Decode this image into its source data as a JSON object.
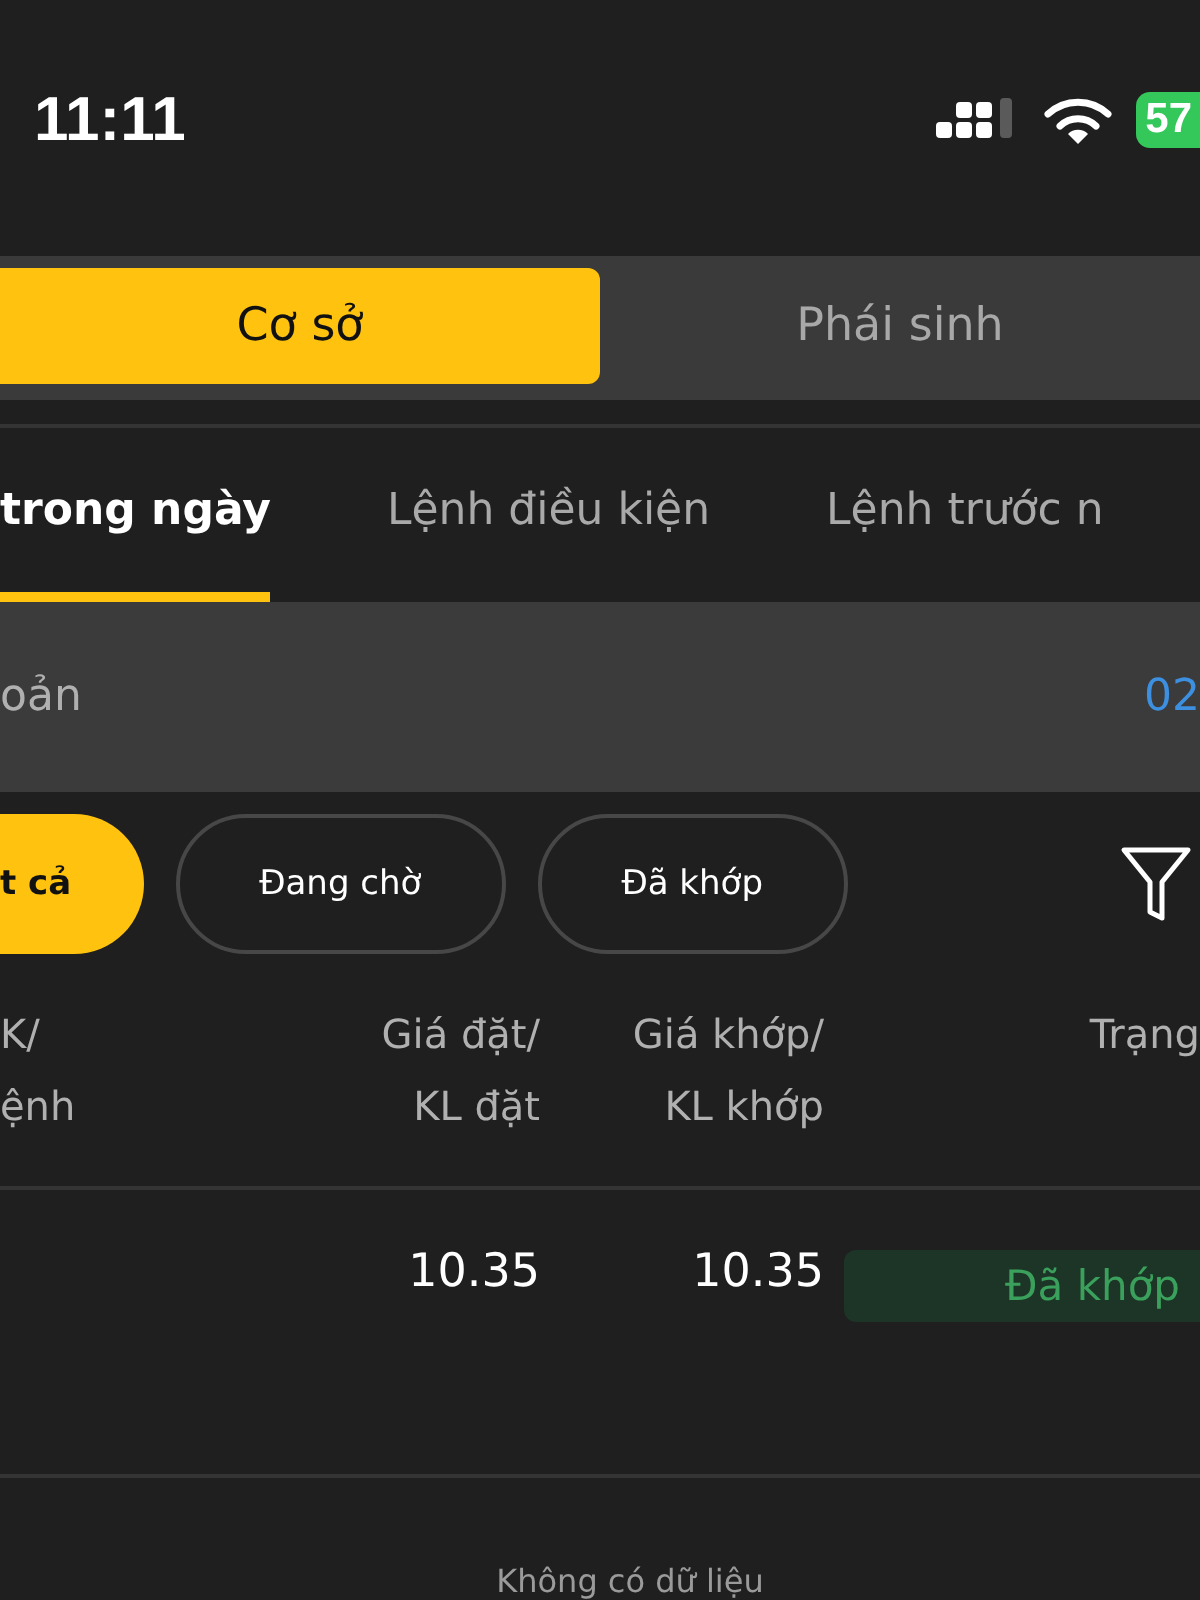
{
  "status_bar": {
    "time": "11:11",
    "battery": "57"
  },
  "market_tabs": [
    {
      "label": "Cơ sở",
      "selected": true
    },
    {
      "label": "Phái sinh",
      "selected": false
    }
  ],
  "order_tabs": [
    {
      "label": "trong ngày",
      "selected": true
    },
    {
      "label": "Lệnh điều kiện",
      "selected": false
    },
    {
      "label": "Lệnh trước n",
      "selected": false
    }
  ],
  "account": {
    "label": "oản",
    "value": "02"
  },
  "filters": [
    {
      "label": "t cả",
      "selected": true
    },
    {
      "label": "Đang chờ",
      "selected": false
    },
    {
      "label": "Đã khớp",
      "selected": false
    }
  ],
  "table": {
    "columns": [
      {
        "label": "K/\nệnh"
      },
      {
        "label": "Giá đặt/\nKL đặt"
      },
      {
        "label": "Giá khớp/\nKL khớp"
      },
      {
        "label": "Trạng"
      }
    ],
    "rows": [
      {
        "order_price": "10.35",
        "matched_price": "10.35",
        "status": {
          "label": "Đã khớp",
          "kind": "matched"
        }
      }
    ]
  },
  "empty_message": "Không có dữ liệu"
}
